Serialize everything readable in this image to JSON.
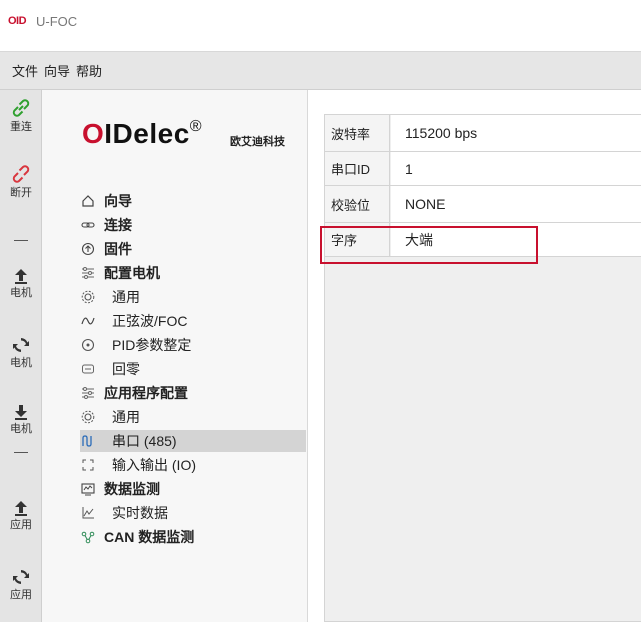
{
  "window": {
    "logo": "OID",
    "title": "U-FOC"
  },
  "menu": {
    "items": [
      "文件",
      "向导",
      "帮助"
    ]
  },
  "toolbar": {
    "tools": [
      {
        "label": "重连",
        "icon": "link-icon"
      },
      {
        "label": "断开",
        "icon": "unlink-icon"
      },
      {
        "label": "电机",
        "icon": "upload-icon"
      },
      {
        "label": "电机",
        "icon": "refresh-icon"
      },
      {
        "label": "电机",
        "icon": "download-icon"
      },
      {
        "label": "应用",
        "icon": "upload-icon"
      },
      {
        "label": "应用",
        "icon": "refresh-icon"
      }
    ]
  },
  "brand": {
    "o": "O",
    "name": "IDelec",
    "reg": "®",
    "subtitle": "欧艾迪科技"
  },
  "nav": [
    {
      "label": "向导",
      "icon": "home-icon",
      "bold": true,
      "sub": false
    },
    {
      "label": "连接",
      "icon": "link-icon",
      "bold": true,
      "sub": false
    },
    {
      "label": "固件",
      "icon": "chip-icon",
      "bold": true,
      "sub": false
    },
    {
      "label": "配置电机",
      "icon": "sliders-icon",
      "bold": true,
      "sub": false
    },
    {
      "label": "通用",
      "icon": "gear-icon",
      "bold": false,
      "sub": true
    },
    {
      "label": "正弦波/FOC",
      "icon": "wave-icon",
      "bold": false,
      "sub": true
    },
    {
      "label": "PID参数整定",
      "icon": "tune-icon",
      "bold": false,
      "sub": true
    },
    {
      "label": "回零",
      "icon": "return-icon",
      "bold": false,
      "sub": true
    },
    {
      "label": "应用程序配置",
      "icon": "sliders-icon",
      "bold": true,
      "sub": false
    },
    {
      "label": "通用",
      "icon": "gear-icon",
      "bold": false,
      "sub": true
    },
    {
      "label": "串口 (485)",
      "icon": "serial-icon",
      "bold": false,
      "sub": true,
      "selected": true
    },
    {
      "label": "输入输出 (IO)",
      "icon": "io-icon",
      "bold": false,
      "sub": true
    },
    {
      "label": "数据监测",
      "icon": "monitor-icon",
      "bold": true,
      "sub": false
    },
    {
      "label": "实时数据",
      "icon": "chart-icon",
      "bold": false,
      "sub": true
    },
    {
      "label": "CAN 数据监测",
      "icon": "can-icon",
      "bold": true,
      "sub": false
    }
  ],
  "settings": [
    {
      "key": "波特率",
      "value": "115200 bps"
    },
    {
      "key": "串口ID",
      "value": "1"
    },
    {
      "key": "校验位",
      "value": "NONE"
    },
    {
      "key": "字序",
      "value": "大端"
    }
  ],
  "colors": {
    "brand_red": "#c8102e",
    "highlight": "#c8102e",
    "link_green": "#2fa02f",
    "unlink_red": "#d9363e"
  }
}
